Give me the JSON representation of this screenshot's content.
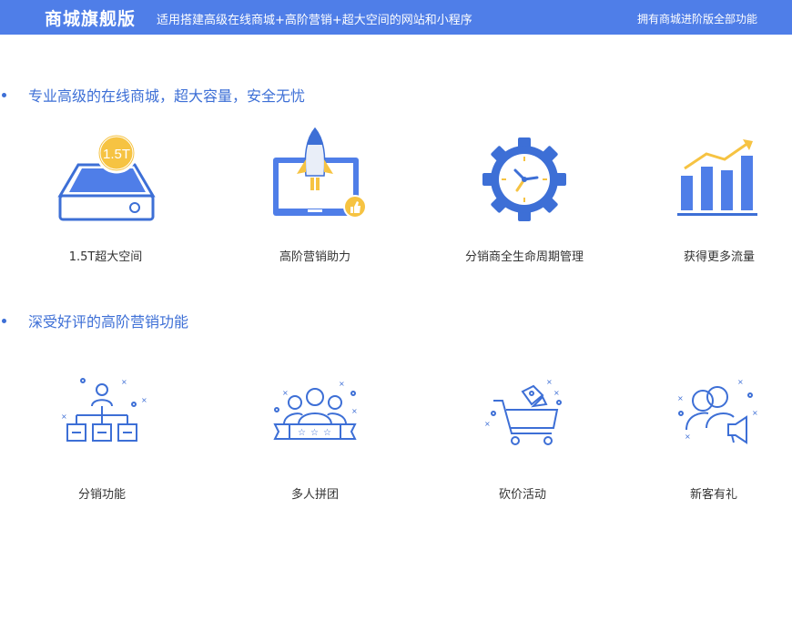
{
  "header": {
    "brand": "商城旗舰版",
    "tagline": "适用搭建高级在线商城+高阶营销+超大空间的网站和小程序",
    "right_note": "拥有商城进阶版全部功能"
  },
  "section1": {
    "title": "专业高级的在线商城，超大容量，安全无忧",
    "storage_badge": "1.5T",
    "features": [
      {
        "label": "1.5T超大空间",
        "icon": "storage-drive-icon"
      },
      {
        "label": "高阶营销助力",
        "icon": "rocket-laptop-icon"
      },
      {
        "label": "分销商全生命周期管理",
        "icon": "gear-clock-icon"
      },
      {
        "label": "获得更多流量",
        "icon": "growth-chart-icon"
      }
    ]
  },
  "section2": {
    "title": "深受好评的高阶营销功能",
    "features": [
      {
        "label": "分销功能",
        "icon": "distribution-tree-icon"
      },
      {
        "label": "多人拼团",
        "icon": "group-buy-icon"
      },
      {
        "label": "砍价活动",
        "icon": "shopping-cart-icon"
      },
      {
        "label": "新客有礼",
        "icon": "new-customer-megaphone-icon"
      }
    ]
  },
  "colors": {
    "primary": "#4f7ee8",
    "accent": "#f6c342",
    "title": "#3d6fd6"
  }
}
